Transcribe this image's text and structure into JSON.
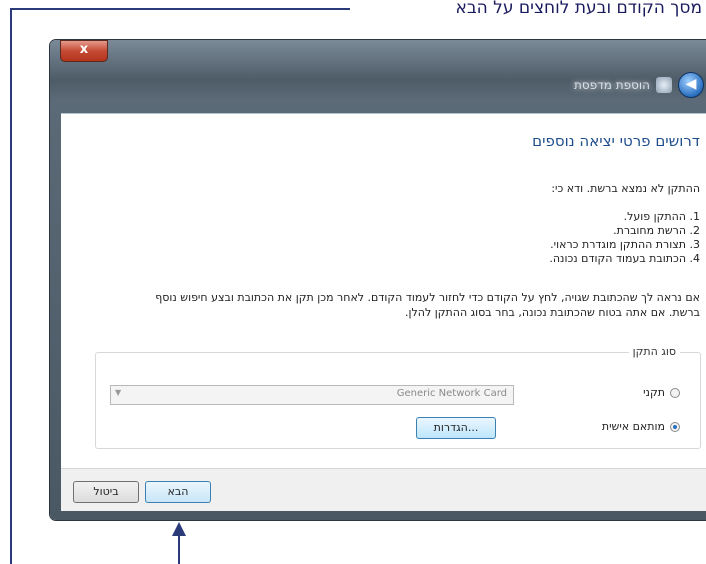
{
  "callout": {
    "text": "מסך הקודם ובעת לוחצים על הבא"
  },
  "window": {
    "close_label": "x",
    "title": "הוספת מדפסת",
    "back_glyph": "◀"
  },
  "page": {
    "heading": "דרושים פרטי יציאה נוספים",
    "intro": "ההתקן לא נמצא ברשת. ודא כי:",
    "steps": [
      "1. ההתקן פועל.",
      "2. הרשת מחוברת.",
      "3. תצורת ההתקן מוגדרת כראוי.",
      "4. הכתובת בעמוד הקודם נכונה."
    ],
    "note": "אם נראה לך שהכתובת שגויה, לחץ על הקודם כדי לחזור לעמוד הקודם. לאחר מכן תקן את הכתובת ובצע חיפוש נוסף ברשת. אם אתה בטוח שהכתובת נכונה, בחר בסוג ההתקן להלן."
  },
  "device_type": {
    "legend": "סוג התקן",
    "standard_label": "תקני",
    "standard_selected": false,
    "combo_value": "Generic Network Card",
    "custom_label": "מותאם אישית",
    "custom_selected": true,
    "settings_button": "הגדרות..."
  },
  "footer": {
    "next_label": "הבא",
    "cancel_label": "ביטול"
  }
}
